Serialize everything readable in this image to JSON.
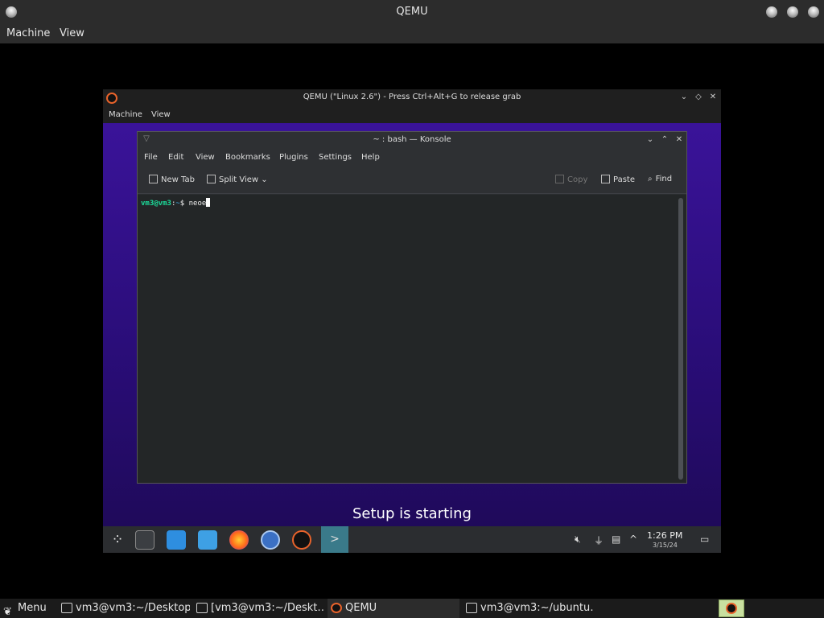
{
  "host": {
    "window_title": "QEMU",
    "menu": [
      "Machine",
      "View"
    ],
    "taskbar": {
      "menu_label": "Menu",
      "items": [
        {
          "label": "vm3@vm3:~/Desktop"
        },
        {
          "label": "[vm3@vm3:~/Deskt…"
        },
        {
          "label": "QEMU"
        },
        {
          "label": "vm3@vm3:~/ubuntu…"
        }
      ]
    }
  },
  "guest": {
    "qemu_window_title": "QEMU (\"Linux 2.6\") - Press Ctrl+Alt+G to release grab",
    "qemu_menu": [
      "Machine",
      "View"
    ],
    "konsole": {
      "title": "~ : bash — Konsole",
      "menu": [
        "File",
        "Edit",
        "View",
        "Bookmarks",
        "Plugins",
        "Settings",
        "Help"
      ],
      "toolbar": {
        "new_tab": "New Tab",
        "split_view": "Split View",
        "copy": "Copy",
        "paste": "Paste",
        "find": "Find"
      },
      "prompt_user": "vm3@vm3",
      "prompt_sep": ":",
      "prompt_path": "~",
      "prompt_symbol": "$",
      "command": "neoe"
    },
    "setup_message": "Setup is starting",
    "clock": {
      "time": "1:26 PM",
      "date": "3/15/24"
    }
  },
  "colors": {
    "guest_background": "#2a0d79",
    "prompt_user": "#1cdc9a",
    "prompt_path": "#3daee9",
    "qemu_logo": "#e8632b",
    "active_task": "#3a7a8a"
  },
  "icons": [
    "qemu-logo-icon",
    "terminal-icon",
    "firefox-icon",
    "files-icon",
    "store-icon",
    "volume-muted-icon",
    "usb-icon",
    "network-icon"
  ]
}
